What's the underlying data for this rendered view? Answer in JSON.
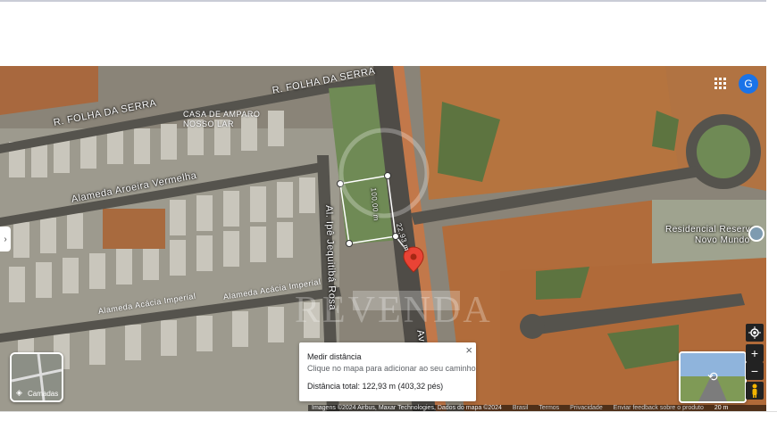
{
  "map": {
    "streets": [
      {
        "id": "r-folha-1",
        "text": "R. FOLHA DA SERRA"
      },
      {
        "id": "r-folha-2",
        "text": "R. FOLHA DA SERRA"
      },
      {
        "id": "casa-amparo",
        "text": "CASA DE AMPARO"
      },
      {
        "id": "nosso-lar",
        "text": "NOSSO LAR"
      },
      {
        "id": "alameda-aroeira",
        "text": "Alameda Aroeira Vermelha"
      },
      {
        "id": "al-ipe",
        "text": "Al. Ipê Jequitibá Rosa"
      },
      {
        "id": "alameda-acacia-1",
        "text": "Alameda Acácia Imperial"
      },
      {
        "id": "alameda-acacia-2",
        "text": "Alameda Acácia Imperial"
      },
      {
        "id": "av",
        "text": "Av."
      },
      {
        "id": "residencial-1",
        "text": "Residencial Reserva"
      },
      {
        "id": "residencial-2",
        "text": "Novo Mundo"
      }
    ],
    "measurements": {
      "segment_a": "100,00 m",
      "segment_b": "22,93 m"
    },
    "watermark": "REVENDA",
    "pin_color": "#ea4335"
  },
  "measure_card": {
    "title": "Medir distância",
    "hint": "Clique no mapa para adicionar ao seu caminho",
    "total": "Distância total: 122,93 m (403,32 pés)",
    "close": "×"
  },
  "layers": {
    "label": "Camadas"
  },
  "account": {
    "initial": "G"
  },
  "controls": {
    "zoom_in": "+",
    "zoom_out": "−",
    "locate_icon": "my-location-icon",
    "pegman_icon": "pegman-icon"
  },
  "footer": {
    "imagery": "Imagens ©2024 Airbus, Maxar Technologies, Dados do mapa ©2024",
    "country": "Brasil",
    "terms": "Termos",
    "privacy": "Privacidade",
    "feedback": "Enviar feedback sobre o produto",
    "scale": "20 m"
  }
}
